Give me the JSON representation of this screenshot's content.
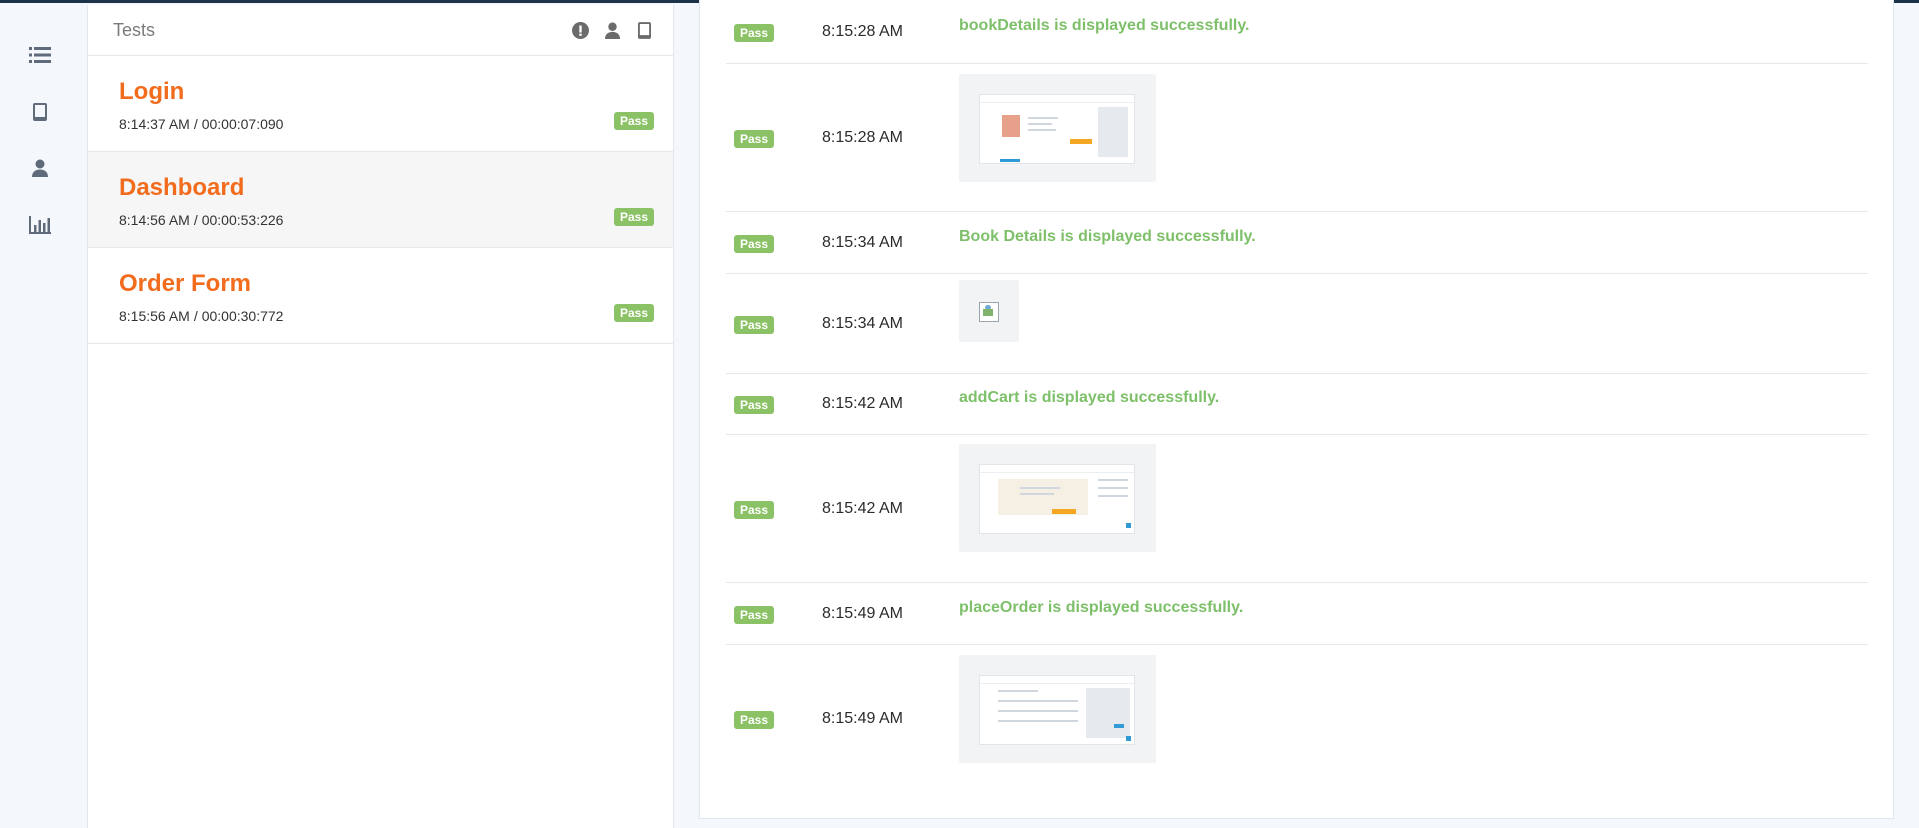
{
  "nav": {
    "items": [
      {
        "name": "list-icon"
      },
      {
        "name": "tablet-icon"
      },
      {
        "name": "user-icon"
      },
      {
        "name": "bar-chart-icon"
      }
    ]
  },
  "tests": {
    "title": "Tests",
    "tools": [
      "exclamation-circle-icon",
      "user-icon",
      "tablet-icon"
    ],
    "items": [
      {
        "name": "Login",
        "start": "8:14:37 AM",
        "separator": "/",
        "duration": "00:00:07:090",
        "status": "Pass"
      },
      {
        "name": "Dashboard",
        "start": "8:14:56 AM",
        "separator": "/",
        "duration": "00:00:53:226",
        "status": "Pass"
      },
      {
        "name": "Order Form",
        "start": "8:15:56 AM",
        "separator": "/",
        "duration": "00:00:30:772",
        "status": "Pass"
      }
    ]
  },
  "logs": [
    {
      "status": "Pass",
      "time": "8:15:28 AM",
      "message": "bookDetails is displayed successfully."
    },
    {
      "status": "Pass",
      "time": "8:15:28 AM",
      "screenshot": "screenshot-thumbnail"
    },
    {
      "status": "Pass",
      "time": "8:15:34 AM",
      "message": "Book Details is displayed successfully."
    },
    {
      "status": "Pass",
      "time": "8:15:34 AM",
      "screenshot": "broken-image"
    },
    {
      "status": "Pass",
      "time": "8:15:42 AM",
      "message": "addCart is displayed successfully."
    },
    {
      "status": "Pass",
      "time": "8:15:42 AM",
      "screenshot": "screenshot-thumbnail"
    },
    {
      "status": "Pass",
      "time": "8:15:49 AM",
      "message": "placeOrder is displayed successfully."
    },
    {
      "status": "Pass",
      "time": "8:15:49 AM",
      "screenshot": "screenshot-thumbnail"
    }
  ],
  "colors": {
    "accent": "#f26c1e",
    "pass": "#8bc265",
    "pass_text": "#7ec06a",
    "topbar": "#1d3448"
  }
}
